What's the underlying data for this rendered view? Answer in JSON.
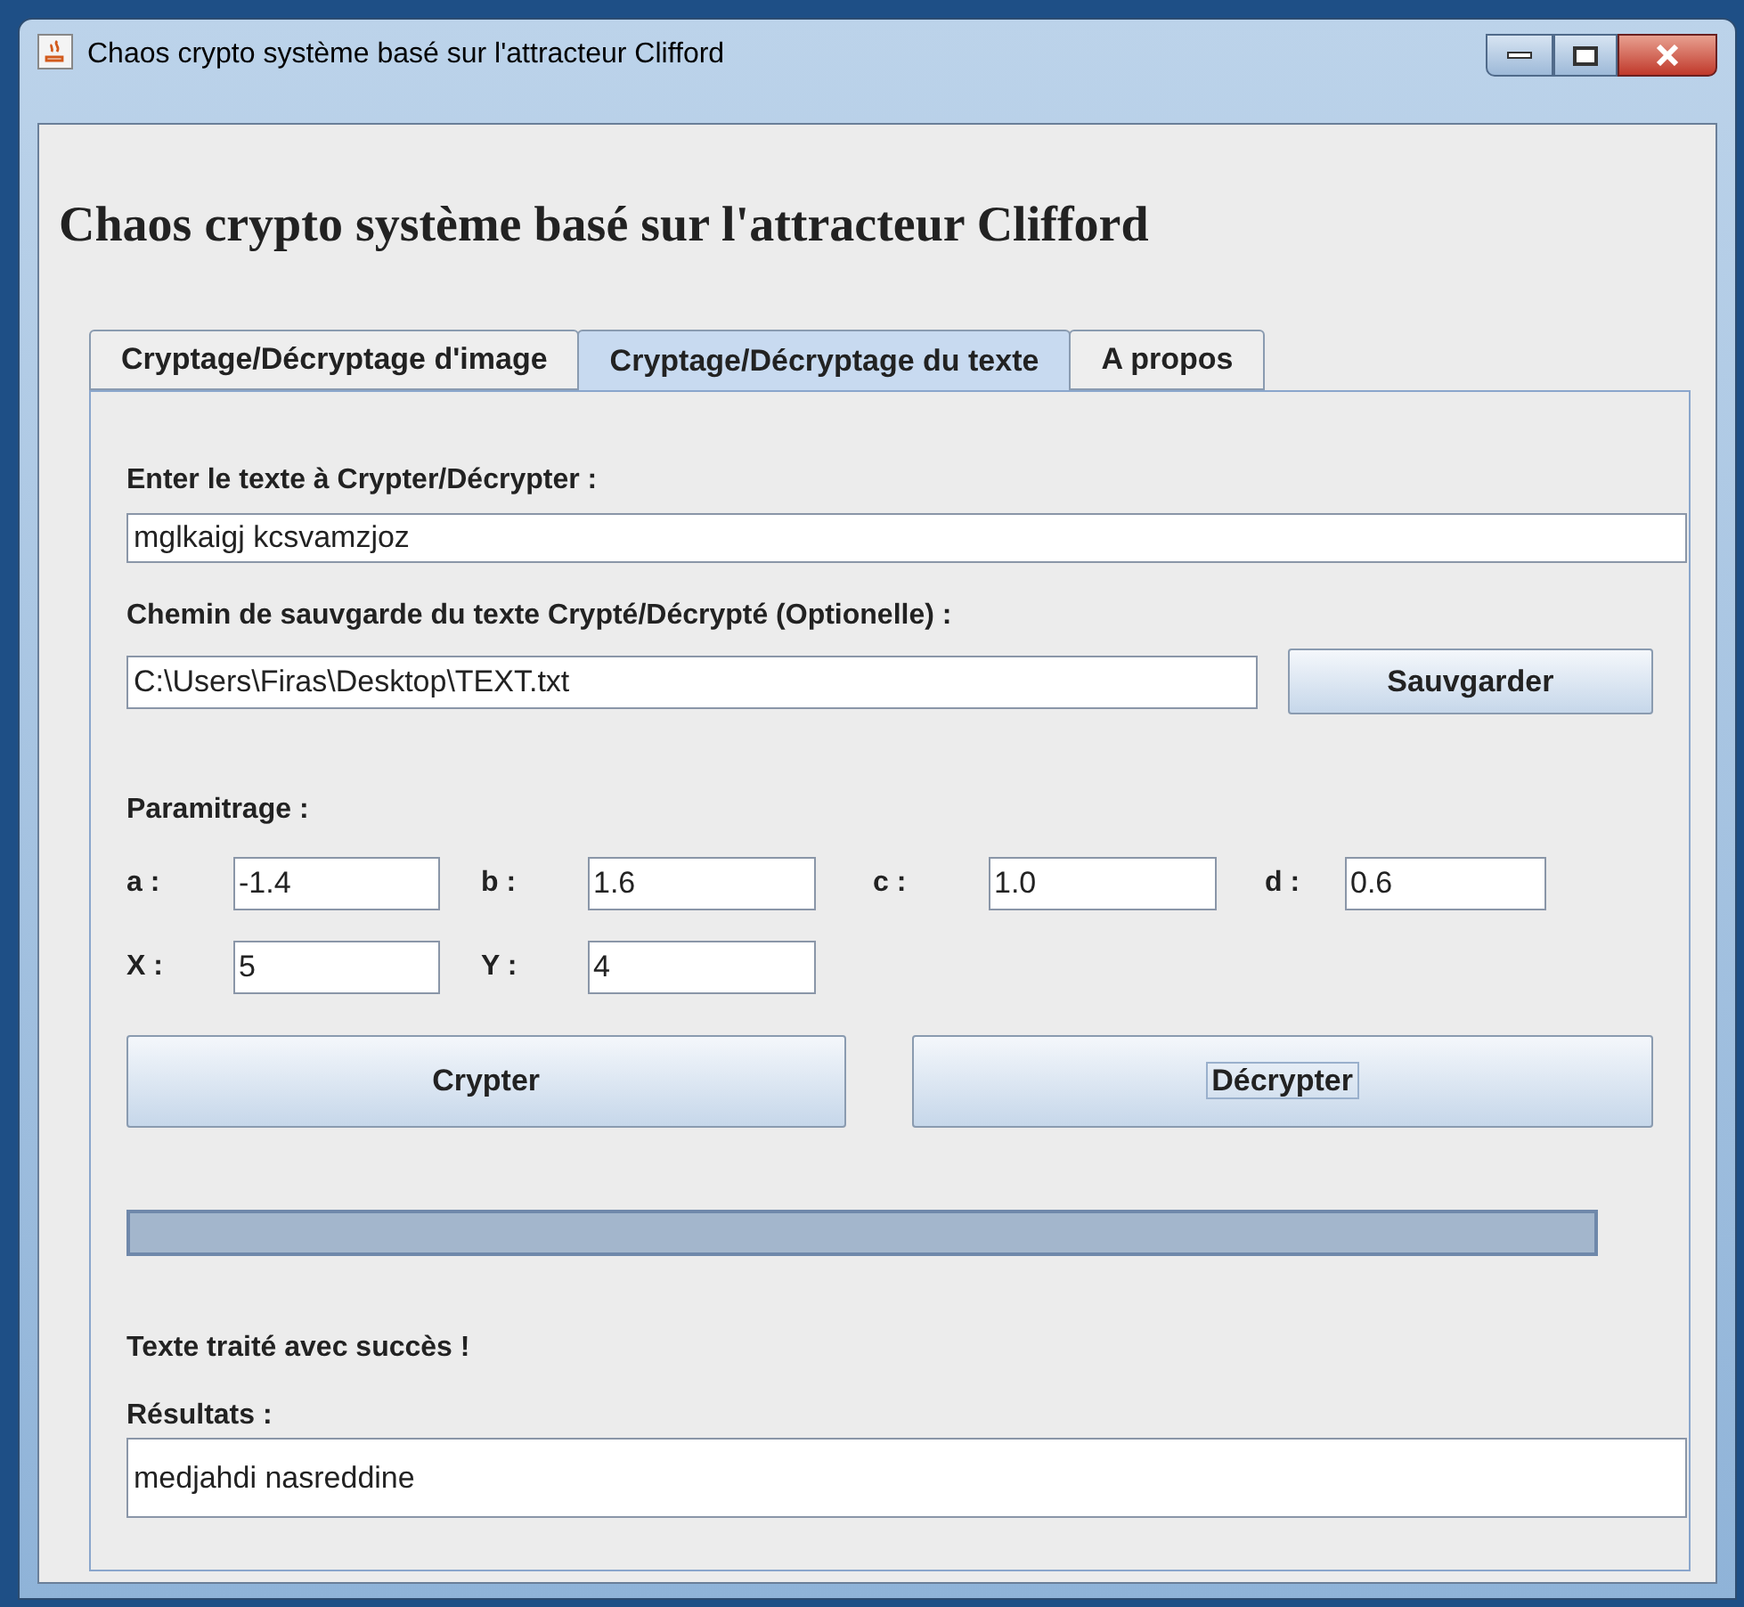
{
  "window": {
    "title": "Chaos crypto système basé sur l'attracteur Clifford"
  },
  "heading": "Chaos crypto système basé sur l'attracteur Clifford",
  "tabs": [
    {
      "label": "Cryptage/Décryptage d'image",
      "selected": false
    },
    {
      "label": "Cryptage/Décryptage du texte",
      "selected": true
    },
    {
      "label": "A propos",
      "selected": false
    }
  ],
  "input_label": "Enter le texte à Crypter/Décrypter :",
  "input_value": "mglkaigj kcsvamzjoz",
  "path_label": "Chemin de sauvgarde du texte Crypté/Décrypté (Optionelle) :",
  "path_value": "C:\\Users\\Firas\\Desktop\\TEXT.txt",
  "save_button": "Sauvgarder",
  "params_label": "Paramitrage :",
  "params": [
    [
      {
        "label": "a :",
        "value": "-1.4"
      },
      {
        "label": "b :",
        "value": "1.6"
      },
      {
        "label": "c :",
        "value": "1.0"
      },
      {
        "label": "d :",
        "value": "0.6"
      }
    ],
    [
      {
        "label": "X :",
        "value": "5"
      },
      {
        "label": "Y :",
        "value": "4"
      }
    ]
  ],
  "actions": [
    {
      "label": "Crypter",
      "focused": false
    },
    {
      "label": "Décrypter",
      "focused": true
    }
  ],
  "progress": {
    "level": 1
  },
  "status": "Texte traité avec succès !",
  "result_label": "Résultats :",
  "result_value": "medjahdi nasreddine"
}
